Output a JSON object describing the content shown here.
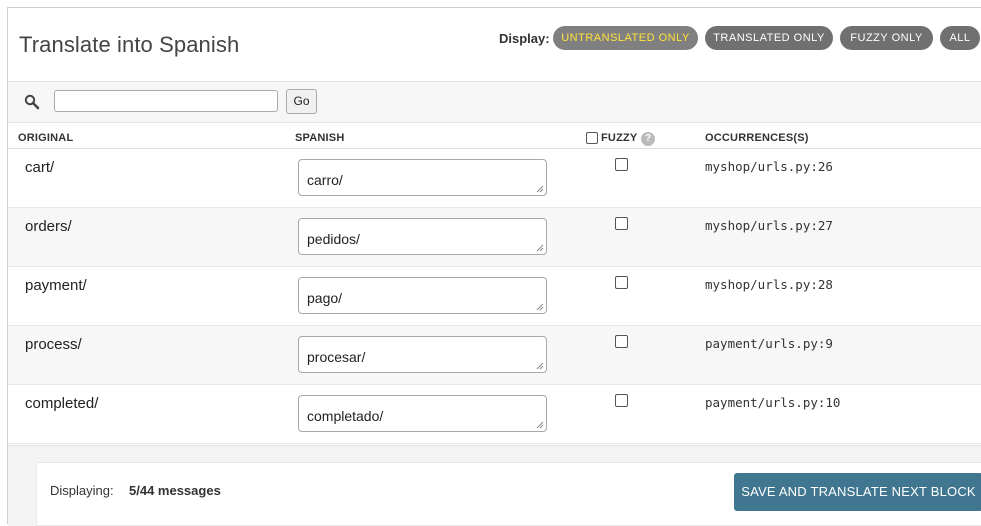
{
  "page": {
    "title": "Translate into Spanish"
  },
  "display_filter": {
    "label": "Display:",
    "options": [
      {
        "label": "UNTRANSLATED ONLY",
        "active": true
      },
      {
        "label": "TRANSLATED ONLY",
        "active": false
      },
      {
        "label": "FUZZY ONLY",
        "active": false
      },
      {
        "label": "ALL",
        "active": false
      }
    ]
  },
  "search": {
    "value": "",
    "placeholder": "",
    "go_label": "Go",
    "icon": "search-icon"
  },
  "table": {
    "headers": {
      "original": "ORIGINAL",
      "translation": "SPANISH",
      "fuzzy": "FUZZY",
      "occurrences": "OCCURRENCES(S)"
    },
    "rows": [
      {
        "original": "cart/",
        "translation": "carro/",
        "fuzzy": false,
        "occurrence": "myshop/urls.py:26"
      },
      {
        "original": "orders/",
        "translation": "pedidos/",
        "fuzzy": false,
        "occurrence": "myshop/urls.py:27"
      },
      {
        "original": "payment/",
        "translation": "pago/",
        "fuzzy": false,
        "occurrence": "myshop/urls.py:28"
      },
      {
        "original": "process/",
        "translation": "procesar/",
        "fuzzy": false,
        "occurrence": "payment/urls.py:9"
      },
      {
        "original": "completed/",
        "translation": "completado/",
        "fuzzy": false,
        "occurrence": "payment/urls.py:10"
      }
    ]
  },
  "footer": {
    "displaying_label": "Displaying:",
    "displaying_value": "5/44 messages",
    "save_label": "SAVE AND TRANSLATE NEXT BLOCK"
  },
  "colors": {
    "pill_bg": "#707070",
    "pill_active_text": "#ffe23a",
    "save_button": "#417690"
  }
}
